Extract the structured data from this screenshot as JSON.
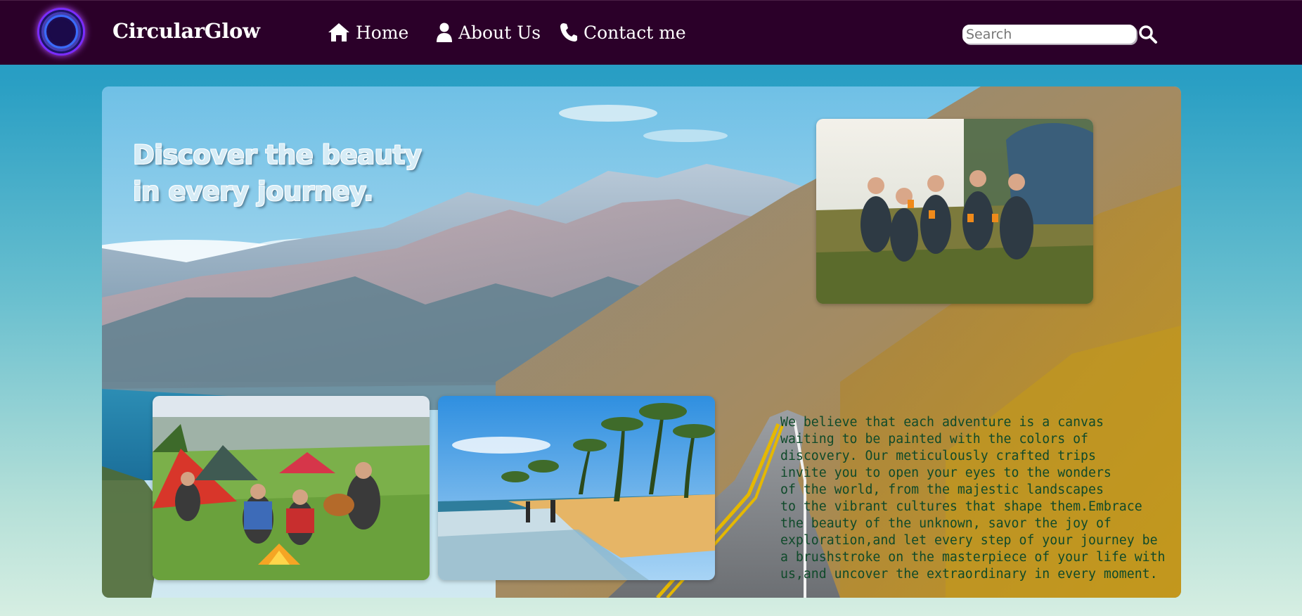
{
  "navbar": {
    "brand": "CircularGlow",
    "items": [
      {
        "label": "Home",
        "icon": "home-icon"
      },
      {
        "label": "About Us",
        "icon": "user-icon"
      },
      {
        "label": "Contact me",
        "icon": "phone-icon"
      }
    ],
    "search": {
      "placeholder": "Search",
      "value": "",
      "icon": "search-icon"
    }
  },
  "hero": {
    "headline_line1": "Discover the beauty",
    "headline_line2": "in every journey.",
    "description": "We believe that each adventure is a canvas\nwaiting to be painted with the colors of\ndiscovery. Our meticulously crafted trips\ninvite you to open your eyes to the wonders\nof the world, from the majestic landscapes\nto the vibrant cultures that shape them.Embrace\nthe beauty of the unknown, savor the joy of\nexploration,and let every step of your journey be\na brushstroke on the masterpiece of your life with\nus,and uncover the extraordinary in every moment."
  },
  "colors": {
    "navbar_bg": "#2b0029",
    "logo_glow": "#b24bff",
    "description_text": "#0f4a2a"
  }
}
